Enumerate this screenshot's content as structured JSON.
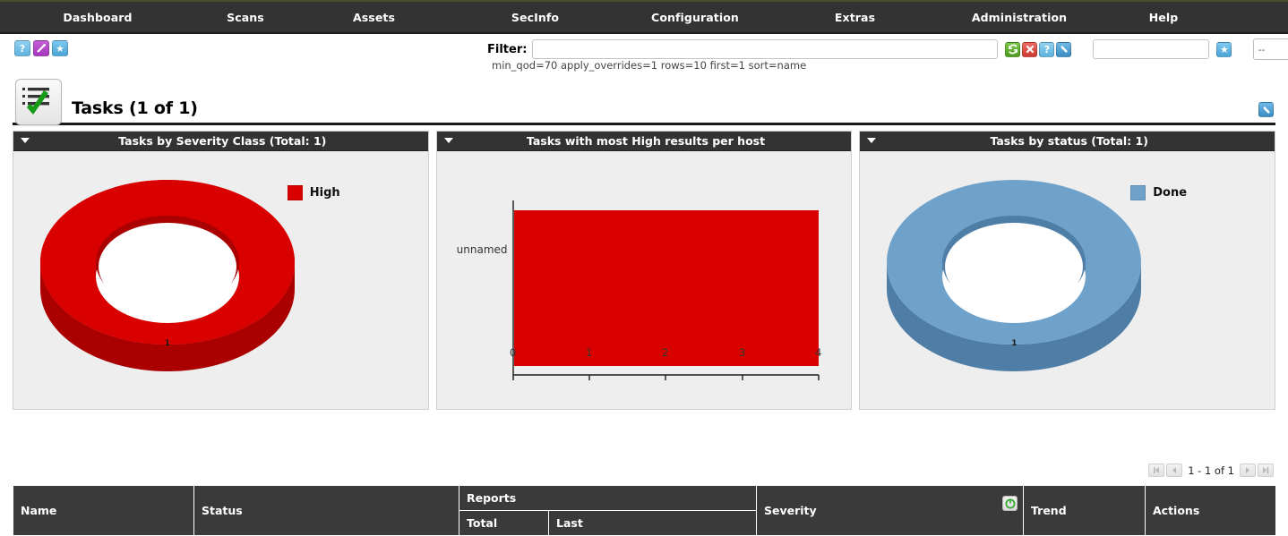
{
  "brand": {
    "accent_top_line": "#4c4b2c",
    "nav_bg": "#333333",
    "panel_head_bg": "#333333",
    "high_red": "#d90000",
    "high_red_dark": "#ab0000",
    "done_blue": "#6fa2cb",
    "done_blue_dark": "#4e7ea6",
    "table_head_bg": "#3a3a3a"
  },
  "nav": {
    "items": [
      {
        "label": "Dashboard",
        "name": "nav-dashboard"
      },
      {
        "label": "Scans",
        "name": "nav-scans"
      },
      {
        "label": "Assets",
        "name": "nav-assets"
      },
      {
        "label": "SecInfo",
        "name": "nav-secinfo"
      },
      {
        "label": "Configuration",
        "name": "nav-configuration"
      },
      {
        "label": "Extras",
        "name": "nav-extras"
      },
      {
        "label": "Administration",
        "name": "nav-administration"
      },
      {
        "label": "Help",
        "name": "nav-help"
      }
    ]
  },
  "quick_icons": [
    {
      "name": "help-icon",
      "glyph": "?"
    },
    {
      "name": "wizard-icon",
      "glyph": "✎"
    },
    {
      "name": "favorite-star-icon",
      "glyph": "★"
    }
  ],
  "filter": {
    "label": "Filter:",
    "value": "",
    "placeholder": "",
    "description": "min_qod=70 apply_overrides=1 rows=10 first=1 sort=name",
    "named_filter_value": "",
    "named_filter_placeholder": "",
    "select_value": "--",
    "actions": [
      {
        "name": "refresh-filter-icon",
        "glyph": "⟳",
        "title": "Update Filter"
      },
      {
        "name": "reset-filter-icon",
        "glyph": "✕",
        "title": "Reset Filter"
      },
      {
        "name": "filter-help-icon",
        "glyph": "?",
        "title": "Help"
      },
      {
        "name": "edit-filter-icon",
        "glyph": "⚒",
        "title": "Edit Filter"
      }
    ],
    "favorite_button": {
      "name": "add-to-favorites-icon",
      "glyph": "★"
    }
  },
  "page": {
    "title": "Tasks (1 of 1)",
    "icon_name": "tasks-list-check-icon",
    "edit_dashboard_icon": {
      "name": "edit-dashboard-icon",
      "glyph": "⚒"
    }
  },
  "panels": [
    {
      "name": "panel-tasks-by-severity-class",
      "title": "Tasks by Severity Class (Total: 1)",
      "chart": "donut-high"
    },
    {
      "name": "panel-tasks-with-most-high-results-per-host",
      "title": "Tasks with most High results per host",
      "chart": "bar-high"
    },
    {
      "name": "panel-tasks-by-status",
      "title": "Tasks by status (Total: 1)",
      "chart": "donut-done"
    }
  ],
  "chart_data": [
    {
      "type": "pie",
      "title": "Tasks by Severity Class (Total: 1)",
      "subtitle": "",
      "variant": "donut-3d",
      "labels": [
        "High"
      ],
      "values": [
        1
      ],
      "total": 1,
      "data_labels": [
        "1"
      ],
      "colors": [
        "#d90000"
      ],
      "legend": [
        "High"
      ],
      "legend_position": "top-right",
      "grid": false
    },
    {
      "type": "bar",
      "title": "Tasks with most High results per host",
      "orientation": "horizontal",
      "categories": [
        "unnamed"
      ],
      "values": [
        4
      ],
      "xlabel": "",
      "ylabel": "",
      "xlim": [
        0,
        4
      ],
      "xticks": [
        "0",
        "1",
        "2",
        "3",
        "4"
      ],
      "colors": [
        "#d90000"
      ],
      "grid": false,
      "legend_position": "none"
    },
    {
      "type": "pie",
      "title": "Tasks by status (Total: 1)",
      "variant": "donut-3d",
      "labels": [
        "Done"
      ],
      "values": [
        1
      ],
      "total": 1,
      "data_labels": [
        "1"
      ],
      "colors": [
        "#6fa2cb"
      ],
      "legend": [
        "Done"
      ],
      "legend_position": "top-right",
      "grid": false
    }
  ],
  "pagination": {
    "text": "1 - 1 of 1",
    "buttons": [
      {
        "name": "first-page-button",
        "dir": "first"
      },
      {
        "name": "previous-page-button",
        "dir": "prev"
      },
      {
        "name": "next-page-button",
        "dir": "next"
      },
      {
        "name": "last-page-button",
        "dir": "last"
      }
    ]
  },
  "table": {
    "columns": {
      "name": "Name",
      "status": "Status",
      "reports": "Reports",
      "reports_total": "Total",
      "reports_last": "Last",
      "severity": "Severity",
      "trend": "Trend",
      "actions": "Actions"
    },
    "sort_indicator_name": "severity-sort-icon",
    "rows": []
  }
}
